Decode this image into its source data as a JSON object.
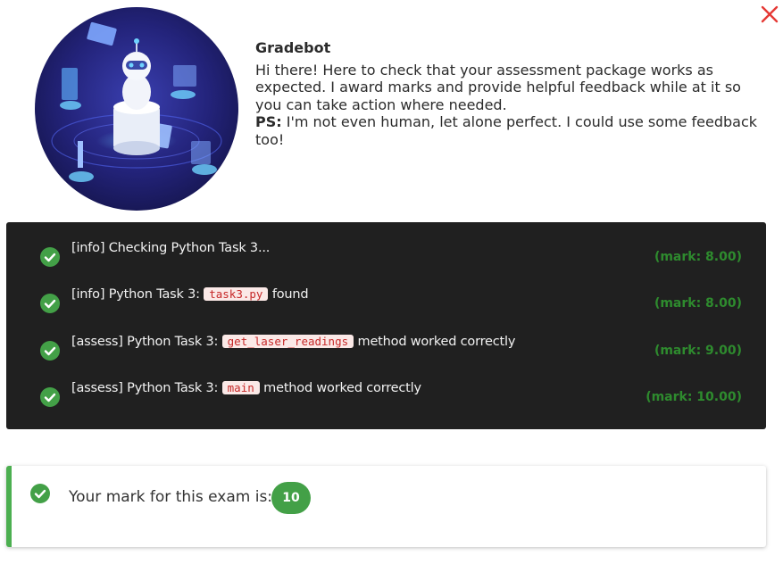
{
  "icons": {
    "close": "close-icon",
    "check": "check-circle-icon",
    "avatar": "robot-illustration"
  },
  "colors": {
    "close": "#e53935",
    "success": "#43a047",
    "mark_text": "#2e8b2e",
    "log_bg": "#202020",
    "code_bg": "#fbe9e7",
    "code_text": "#c62828"
  },
  "bot": {
    "name": "Gradebot",
    "intro": "Hi there! Here to check that your assessment package works as expected. I award marks and provide helpful feedback while at it so you can take action where needed.",
    "ps_label": "PS:",
    "ps_text": " I'm not even human, let alone perfect. I could use some feedback too!"
  },
  "log": [
    {
      "before": "[info] Checking Python Task 3...",
      "code": "",
      "after": "",
      "mark": "(mark: 8.00)"
    },
    {
      "before": "[info] Python Task 3: ",
      "code": "task3.py",
      "after": " found",
      "mark": "(mark: 8.00)"
    },
    {
      "before": "[assess] Python Task 3: ",
      "code": "get_laser_readings",
      "after": " method worked correctly",
      "mark": "(mark: 9.00)"
    },
    {
      "before": "[assess] Python Task 3: ",
      "code": "main",
      "after": " method worked correctly",
      "mark": "(mark: 10.00)"
    }
  ],
  "result": {
    "label": "Your mark for this exam is:",
    "score": "10"
  }
}
